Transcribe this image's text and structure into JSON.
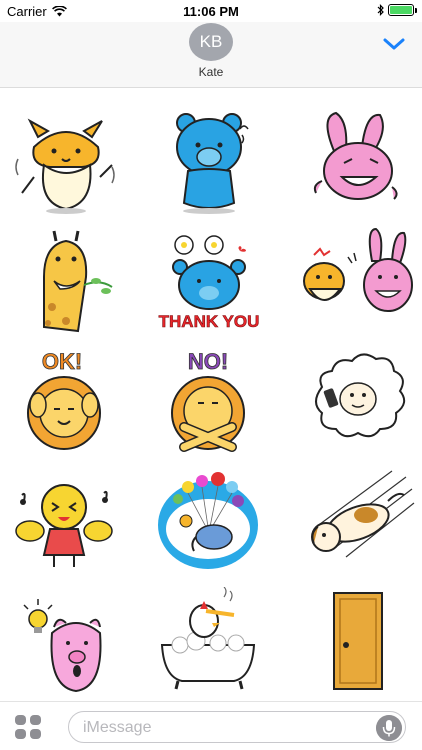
{
  "status_bar": {
    "carrier": "Carrier",
    "time": "11:06 PM",
    "battery_level": 1.0,
    "battery_color": "#4cd964"
  },
  "header": {
    "avatar_initials": "KB",
    "contact_name": "Kate",
    "collapse_icon": "chevron-down-icon",
    "accent_color": "#1a82fb"
  },
  "stickers": [
    {
      "name": "hamster-dancing"
    },
    {
      "name": "blue-bear-sweating"
    },
    {
      "name": "pink-rabbit-grinning"
    },
    {
      "name": "giraffe-eating-leaves"
    },
    {
      "name": "blue-bear-thank-you",
      "text": "THANK YOU"
    },
    {
      "name": "hamster-and-rabbit-arguing"
    },
    {
      "name": "lion-ok",
      "text": "OK!"
    },
    {
      "name": "lion-no",
      "text": "NO!"
    },
    {
      "name": "sheep-with-phone"
    },
    {
      "name": "cheering-chick"
    },
    {
      "name": "elephant-balloons"
    },
    {
      "name": "dog-running"
    },
    {
      "name": "pig-with-lightbulb"
    },
    {
      "name": "chicken-in-bathtub"
    },
    {
      "name": "door"
    }
  ],
  "input": {
    "placeholder": "iMessage",
    "apps_icon": "app-drawer-icon",
    "mic_icon": "microphone-icon"
  }
}
